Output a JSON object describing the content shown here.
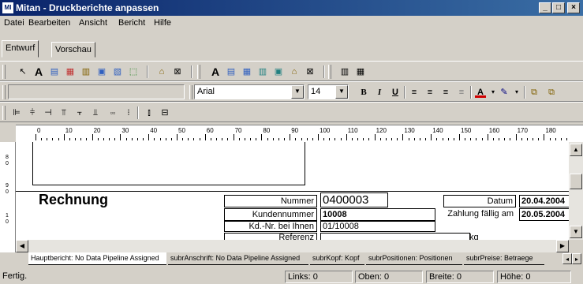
{
  "window": {
    "title": "Mitan - Druckberichte anpassen",
    "app_icon": "MI"
  },
  "menu": [
    "Datei",
    "Bearbeiten",
    "Ansicht",
    "Bericht",
    "Hilfe"
  ],
  "tabs": [
    "Entwurf",
    "Vorschau"
  ],
  "format": {
    "font": "Arial",
    "size": "14"
  },
  "ruler": [
    "0",
    "10",
    "20",
    "30",
    "40",
    "50",
    "60",
    "70",
    "80",
    "90",
    "100",
    "110",
    "120",
    "130",
    "140",
    "150",
    "160",
    "170",
    "180"
  ],
  "vruler": [
    "8",
    "0",
    "9",
    "0",
    "1",
    "0",
    "1"
  ],
  "report": {
    "heading": "Rechnung",
    "labels": {
      "nummer": "Nummer",
      "kundennummer": "Kundennummer",
      "kdnr": "Kd.-Nr. bei Ihnen",
      "referenz": "Referenz",
      "datum": "Datum",
      "zahlung": "Zahlung fällig am"
    },
    "values": {
      "nummer": "0400003",
      "kundennummer": "10008",
      "kdnr": "01/10008",
      "datum": "20.04.2004",
      "zahlung": "20.05.2004",
      "kg": "kg"
    }
  },
  "sheet_tabs": [
    "Hauptbericht: No Data Pipeline Assigned",
    "subrAnschrift: No Data Pipeline Assigned",
    "subrKopf: Kopf",
    "subrPositionen: Positionen",
    "subrPreise: Betraege"
  ],
  "status": {
    "text": "Fertig.",
    "links": "Links: 0",
    "oben": "Oben: 0",
    "breite": "Breite: 0",
    "hoehe": "Höhe: 0"
  }
}
